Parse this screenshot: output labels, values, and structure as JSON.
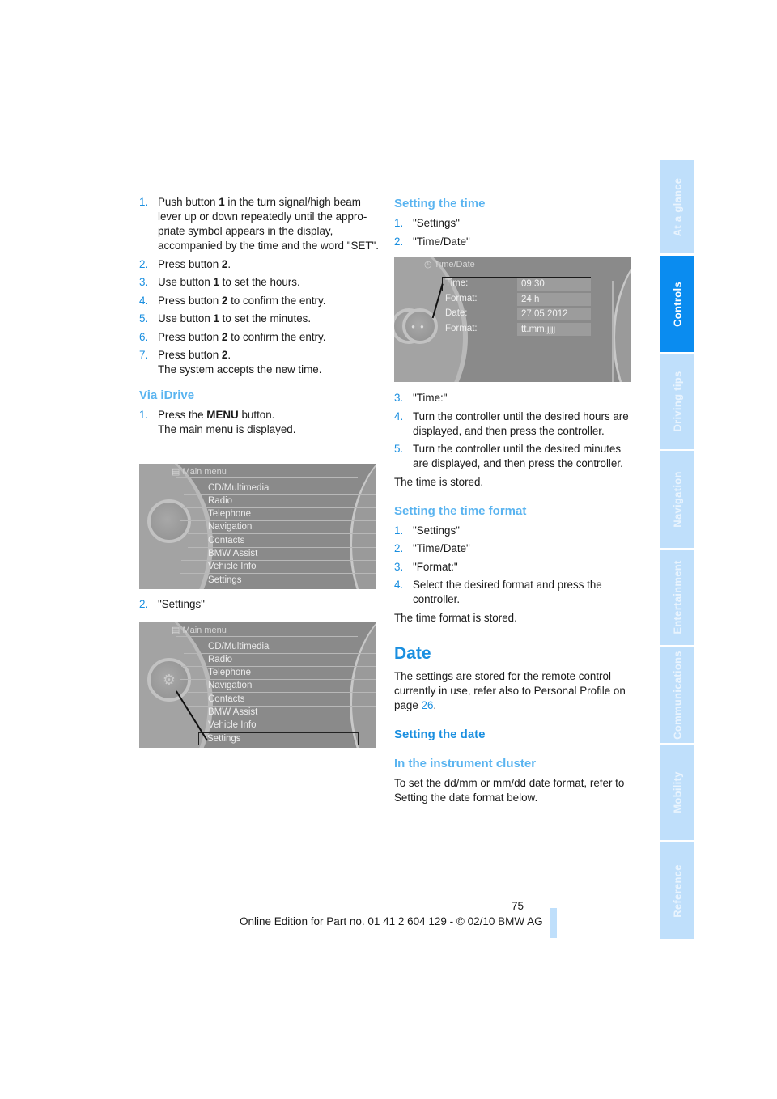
{
  "left_column": {
    "steps_a": [
      {
        "num": "1.",
        "parts": [
          "Push button ",
          "1",
          " in the turn signal/high beam lever up or down repeatedly until the appro­priate symbol appears in the display, accompanied by the time and the word \"SET\"."
        ]
      },
      {
        "num": "2.",
        "parts": [
          "Press button ",
          "2",
          "."
        ]
      },
      {
        "num": "3.",
        "parts": [
          "Use button ",
          "1",
          " to set the hours."
        ]
      },
      {
        "num": "4.",
        "parts": [
          "Press button ",
          "2",
          " to confirm the entry."
        ]
      },
      {
        "num": "5.",
        "parts": [
          "Use button ",
          "1",
          " to set the minutes."
        ]
      },
      {
        "num": "6.",
        "parts": [
          "Press button ",
          "2",
          " to confirm the entry."
        ]
      },
      {
        "num": "7.",
        "parts": [
          "Press button ",
          "2",
          "."
        ],
        "extra": "The system accepts the new time."
      }
    ],
    "via_idrive_heading": "Via iDrive",
    "idrive_step1": {
      "num": "1.",
      "pre": "Press the ",
      "bold": "MENU",
      "post": " button.",
      "extra": "The main menu is displayed."
    },
    "idrive_step2": {
      "num": "2.",
      "text": "\"Settings\""
    },
    "main_menu_screen": {
      "title": "Main menu",
      "items": [
        "CD/Multimedia",
        "Radio",
        "Telephone",
        "Navigation",
        "Contacts",
        "BMW Assist",
        "Vehicle Info",
        "Settings"
      ],
      "selected": "Settings"
    }
  },
  "right_column": {
    "setting_time_heading": "Setting the time",
    "setting_time_steps": [
      {
        "num": "1.",
        "text": "\"Settings\""
      },
      {
        "num": "2.",
        "text": "\"Time/Date\""
      }
    ],
    "timedate_screen": {
      "title": "Time/Date",
      "rows": [
        {
          "label": "Time:",
          "value": "09:30"
        },
        {
          "label": "Format:",
          "value": "24 h"
        },
        {
          "label": "Date:",
          "value": "27.05.2012"
        },
        {
          "label": "Format:",
          "value": "tt.mm.jjjj"
        }
      ],
      "selected": "Time:"
    },
    "setting_time_steps_b": [
      {
        "num": "3.",
        "text": "\"Time:\""
      },
      {
        "num": "4.",
        "text": "Turn the controller until the desired hours are displayed, and then press the controller."
      },
      {
        "num": "5.",
        "text": "Turn the controller until the desired minutes are displayed, and then press the controller."
      }
    ],
    "time_stored": "The time is stored.",
    "time_format_heading": "Setting the time format",
    "time_format_steps": [
      {
        "num": "1.",
        "text": "\"Settings\""
      },
      {
        "num": "2.",
        "text": "\"Time/Date\""
      },
      {
        "num": "3.",
        "text": "\"Format:\""
      },
      {
        "num": "4.",
        "text": "Select the desired format and press the controller."
      }
    ],
    "time_format_stored": "The time format is stored.",
    "date_heading": "Date",
    "date_para_pre": "The settings are stored for the remote control currently in use, refer also to Personal Profile on page ",
    "date_para_link": "26",
    "date_para_post": ".",
    "setting_date_heading": "Setting the date",
    "instrument_cluster_heading": "In the instrument cluster",
    "instrument_cluster_para": "To set the dd/mm or mm/dd date format, refer to Setting the date format below."
  },
  "side_tabs": [
    {
      "label": "At a glance",
      "active": false
    },
    {
      "label": "Controls",
      "active": true
    },
    {
      "label": "Driving tips",
      "active": false
    },
    {
      "label": "Navigation",
      "active": false
    },
    {
      "label": "Entertainment",
      "active": false
    },
    {
      "label": "Communications",
      "active": false
    },
    {
      "label": "Mobility",
      "active": false
    },
    {
      "label": "Reference",
      "active": false
    }
  ],
  "footer": {
    "page_number": "75",
    "edition": "Online Edition for Part no. 01 41 2 604 129 - © 02/10 BMW AG"
  },
  "colors": {
    "accent": "#1a8fe0",
    "subheading": "#5ab4f0",
    "tab_active": "#0a8cf0",
    "tab_inactive": "#bfdffb"
  }
}
